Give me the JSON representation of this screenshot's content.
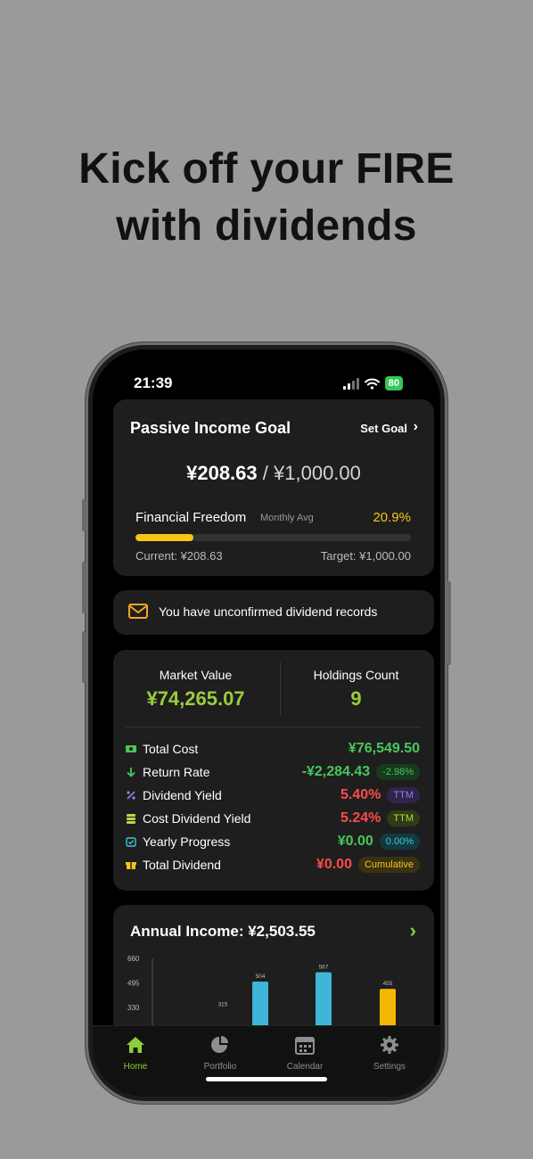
{
  "headline": {
    "line1": "Kick off your FIRE",
    "line2": "with dividends"
  },
  "status_bar": {
    "time": "21:39",
    "battery": "80"
  },
  "goal_card": {
    "title": "Passive Income Goal",
    "set_goal_label": "Set Goal",
    "current_amount": "¥208.63",
    "separator": "/",
    "target_amount": "¥1,000.00",
    "progress_label": "Financial Freedom",
    "progress_sublabel": "Monthly Avg",
    "progress_percent_text": "20.9%",
    "progress_fraction": 0.209,
    "current_text": "Current: ¥208.63",
    "target_text": "Target: ¥1,000.00"
  },
  "notice": {
    "text": "You have unconfirmed dividend records",
    "icon": "mail-icon"
  },
  "summary": {
    "market_value_label": "Market Value",
    "market_value": "¥74,265.07",
    "holdings_label": "Holdings Count",
    "holdings_count": "9",
    "metrics": [
      {
        "name": "Total Cost",
        "value": "¥76,549.50",
        "value_color": "#46c85a",
        "tag": "",
        "icon": "cash-icon",
        "icon_color": "#46c85a"
      },
      {
        "name": "Return Rate",
        "value": "-¥2,284.43",
        "value_color": "#46c85a",
        "tag": "-2.98%",
        "tag_color": "#46c85a",
        "tag_bg": "#173a1f",
        "icon": "arrow-down-icon",
        "icon_color": "#46c85a"
      },
      {
        "name": "Dividend Yield",
        "value": "5.40%",
        "value_color": "#ff4b4b",
        "tag": "TTM",
        "tag_color": "#9a7cf0",
        "tag_bg": "#2e2548",
        "icon": "percent-icon",
        "icon_color": "#9a7cf0"
      },
      {
        "name": "Cost Dividend Yield",
        "value": "5.24%",
        "value_color": "#ff4b4b",
        "tag": "TTM",
        "tag_color": "#b6d94a",
        "tag_bg": "#2f3a16",
        "icon": "coins-icon",
        "icon_color": "#b6d94a"
      },
      {
        "name": "Yearly Progress",
        "value": "¥0.00",
        "value_color": "#46c85a",
        "tag": "0.00%",
        "tag_color": "#3ec9d6",
        "tag_bg": "#123a3e",
        "icon": "calendar-check-icon",
        "icon_color": "#3ec9d6"
      },
      {
        "name": "Total Dividend",
        "value": "¥0.00",
        "value_color": "#ff4b4b",
        "tag": "Cumulative",
        "tag_color": "#f5c518",
        "tag_bg": "#3a3112",
        "icon": "gift-icon",
        "icon_color": "#f5c518"
      }
    ]
  },
  "annual_income": {
    "title": "Annual Income: ¥2,503.55"
  },
  "chart_data": {
    "type": "bar",
    "title": "",
    "y_ticks": [
      "660",
      "495",
      "330"
    ],
    "ylim": [
      0,
      660
    ],
    "values": [
      315,
      504,
      567,
      455
    ],
    "value_labels": [
      "315",
      "504",
      "567",
      "455"
    ],
    "colors": [
      "#3fb5d8",
      "#3fb5d8",
      "#3fb5d8",
      "#f5b800"
    ]
  },
  "tabbar": {
    "tabs": [
      {
        "label": "Home",
        "active": true,
        "icon": "home-icon"
      },
      {
        "label": "Portfolio",
        "active": false,
        "icon": "pie-chart-icon"
      },
      {
        "label": "Calendar",
        "active": false,
        "icon": "calendar-icon"
      },
      {
        "label": "Settings",
        "active": false,
        "icon": "gear-icon"
      }
    ]
  },
  "colors": {
    "accent_green": "#8ccf3a",
    "yellow": "#f5c518",
    "card_bg": "#1e1e1e"
  }
}
